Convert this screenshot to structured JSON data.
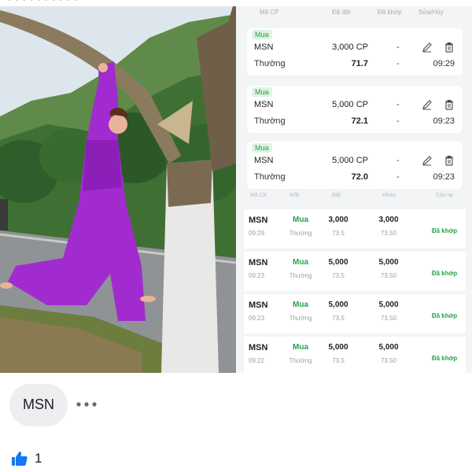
{
  "column_headers": [
    "Mã CP",
    "Đã đặt",
    "Đã khớp",
    "Sửa/Hủy"
  ],
  "pending_orders": [
    {
      "side": "Mua",
      "symbol": "MSN",
      "quantity": "3,000 CP",
      "order_type": "Thường",
      "price": "71.7",
      "filled": "-",
      "filled_price": "-",
      "time": "09:29"
    },
    {
      "side": "Mua",
      "symbol": "MSN",
      "quantity": "5,000 CP",
      "order_type": "Thường",
      "price": "72.1",
      "filled": "-",
      "filled_price": "-",
      "time": "09:23"
    },
    {
      "side": "Mua",
      "symbol": "MSN",
      "quantity": "5,000 CP",
      "order_type": "Thường",
      "price": "72.0",
      "filled": "-",
      "filled_price": "-",
      "time": "09:23"
    }
  ],
  "history_headers": [
    "Mã CK",
    "M/B",
    "Đặt",
    "Khớp",
    "Còn lại"
  ],
  "history_orders": [
    {
      "symbol": "MSN",
      "time": "09:29",
      "side": "Mua",
      "order_type": "Thường",
      "quantity": "3,000",
      "price": "73.5",
      "filled_qty": "3,000",
      "filled_price": "73.50",
      "status": "Đã khớp"
    },
    {
      "symbol": "MSN",
      "time": "09:23",
      "side": "Mua",
      "order_type": "Thường",
      "quantity": "5,000",
      "price": "73.5",
      "filled_qty": "5,000",
      "filled_price": "73.50",
      "status": "Đã khớp"
    },
    {
      "symbol": "MSN",
      "time": "09:23",
      "side": "Mua",
      "order_type": "Thường",
      "quantity": "5,000",
      "price": "73.5",
      "filled_qty": "5,000",
      "filled_price": "73.50",
      "status": "Đã khớp"
    },
    {
      "symbol": "MSN",
      "time": "09:22",
      "side": "Mua",
      "order_type": "Thường",
      "quantity": "5,000",
      "price": "73.5",
      "filled_qty": "5,000",
      "filled_price": "73.50",
      "status": "Đã khớp"
    }
  ],
  "comment": {
    "text": "MSN",
    "more_icon": "more-dots-icon",
    "like_icon": "thumbs-up-icon",
    "like_count": "1"
  },
  "colors": {
    "buy_green": "#27a148",
    "badge_bg": "#dff3e4",
    "like_blue": "#1877f2"
  },
  "photo": {
    "description_icon": "photo-woman-hanging-on-tree"
  }
}
